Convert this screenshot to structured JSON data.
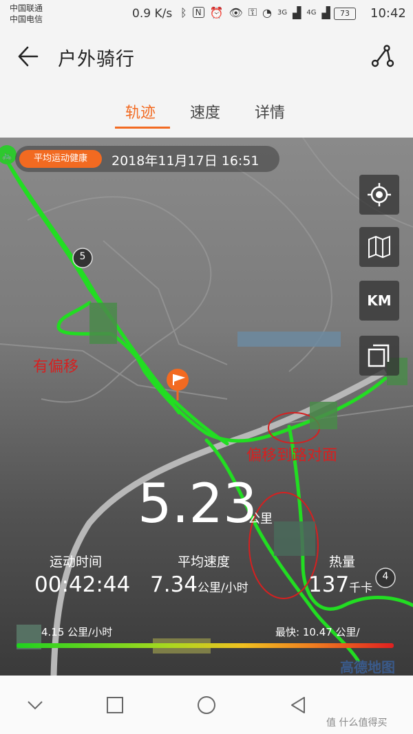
{
  "status_bar": {
    "carrier_1": "中国联通",
    "carrier_2": "中国电信",
    "net_speed": "0.9 K/s",
    "signal_1": "3G",
    "signal_2": "4G",
    "battery": "73",
    "time": "10:42"
  },
  "app_bar": {
    "title": "户外骑行"
  },
  "tabs": [
    {
      "label": "轨迹",
      "active": true
    },
    {
      "label": "速度",
      "active": false
    },
    {
      "label": "详情",
      "active": false
    }
  ],
  "map": {
    "method_badge": "平均运动健康",
    "track_date": "2018年11月17日 16:51",
    "km_marker": "5",
    "km_marker_2": "4",
    "controls": {
      "locate_icon": "target-icon",
      "layer_icon": "map-layer-icon",
      "km_label": "KM",
      "copy_icon": "layers-icon"
    },
    "annotations": {
      "offset": "有偏移",
      "offset_to_opposite": "偏移到路对面"
    },
    "provider": "高德地图"
  },
  "summary": {
    "distance": "5.23",
    "distance_unit": "公里",
    "stats": [
      {
        "label": "运动时间",
        "value": "00:42:44",
        "unit": ""
      },
      {
        "label": "平均速度",
        "value": "7.34",
        "unit": "公里/小时"
      },
      {
        "label": "热量",
        "value": "137",
        "unit": "千卡"
      }
    ],
    "speed_min": "4.15 公里/小时",
    "speed_max_label": "最快:",
    "speed_max": "10.47 公里/"
  },
  "watermark": "值 什么值得买",
  "colors": {
    "accent": "#f26a21",
    "track": "#22dd22",
    "annotation": "#d62020"
  }
}
